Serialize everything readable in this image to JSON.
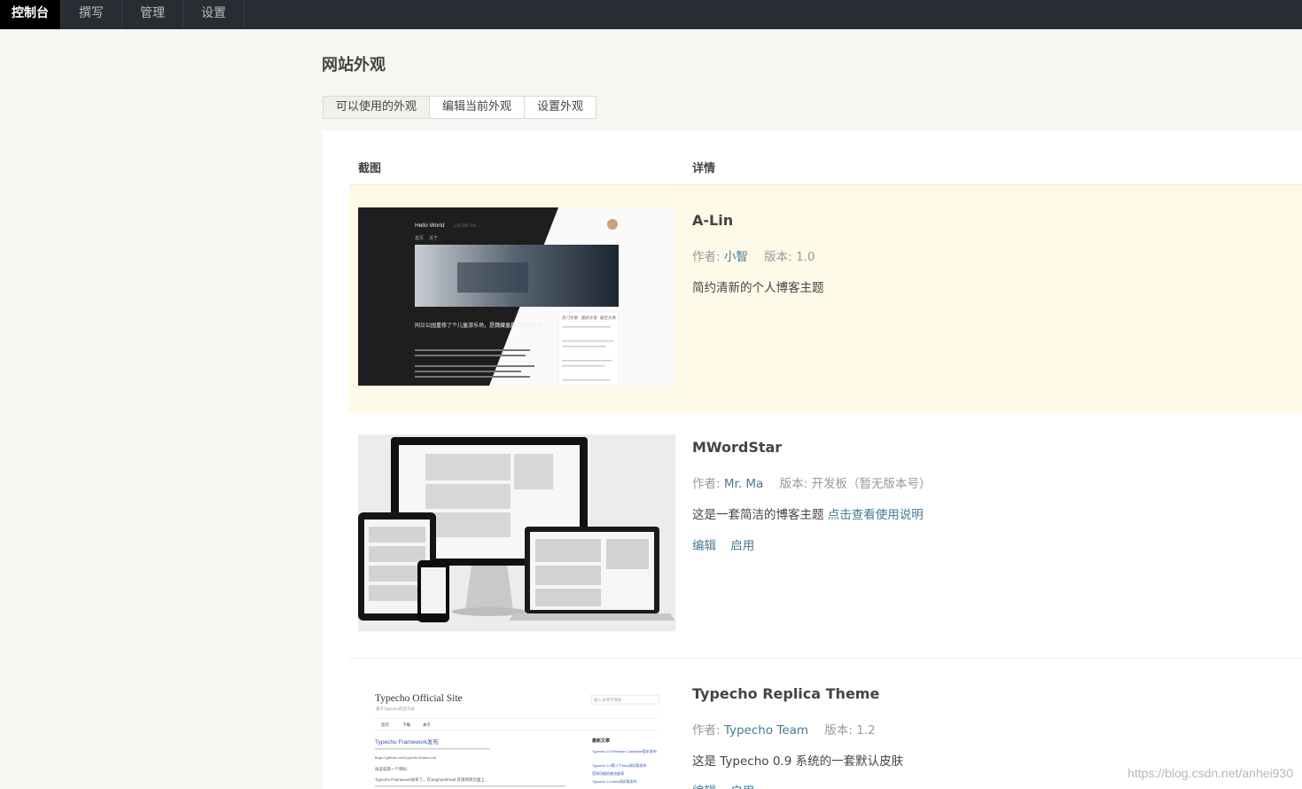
{
  "nav": {
    "items": [
      "控制台",
      "撰写",
      "管理",
      "设置"
    ]
  },
  "page_title": "网站外观",
  "tabs": [
    "可以使用的外观",
    "编辑当前外观",
    "设置外观"
  ],
  "table": {
    "col_screenshot": "截图",
    "col_details": "详情"
  },
  "themes": [
    {
      "name": "A-Lin",
      "author_label": "作者:",
      "author": "小智",
      "version_label": "版本:",
      "version": "1.0",
      "description": "简约清新的个人博客主题",
      "thumb": {
        "title": "Hello World",
        "subtitle": "Let be be...",
        "nav": [
          "首页",
          "关于"
        ],
        "post_title": "同兰公园重修了个儿童游乐场，是魏藏童趣的科幻风格",
        "tabs": [
          "热门文章",
          "最新文章",
          "最近文章"
        ]
      }
    },
    {
      "name": "MWordStar",
      "author_label": "作者:",
      "author": "Mr. Ma",
      "version_label": "版本:",
      "version": "开发板（暂无版本号）",
      "description": "这是一套简洁的博客主题",
      "doc_link": "点击查看使用说明",
      "actions": [
        "编辑",
        "启用"
      ]
    },
    {
      "name": "Typecho Replica Theme",
      "author_label": "作者:",
      "author": "Typecho Team",
      "version_label": "版本:",
      "version": "1.2",
      "description": "这是 Typecho 0.9 系统的一套默认皮肤",
      "actions": [
        "编辑",
        "启用"
      ],
      "thumb": {
        "site_title": "Typecho Official Site",
        "site_sub": "基于Typecho的官方站",
        "search_placeholder": "输入关键字搜索",
        "nav": [
          "首页",
          "下载",
          "关于"
        ],
        "post_title": "Typecho Framework发布",
        "sidebar_title": "最新文章",
        "sidebar_links": [
          "Typecho 0.9 Release Candidate版本发布",
          "Typecho 0.9第二个beta测试版发布",
          "官网功能检查进度表",
          "Typecho 0.9 beta测试版发布"
        ],
        "body_line1": "https://github.com/typecho/framework",
        "body_line2": "再说说第一个目标:",
        "body_line3": "Typecho Framework发布了。在SegmentFault 开源项目页面上..."
      }
    }
  ],
  "watermark": "https://blog.csdn.net/anhei930"
}
